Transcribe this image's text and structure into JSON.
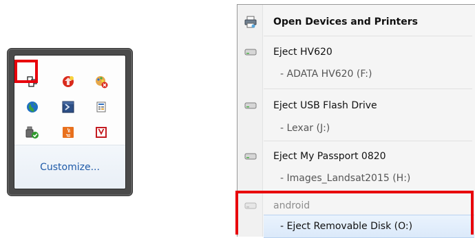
{
  "tray_popup": {
    "customize_label": "Customize...",
    "icons": [
      "network-windows-icon",
      "security-red-icon",
      "palette-x-icon",
      "globe-icon",
      "powershell-arrow-icon",
      "document-grid-icon",
      "usb-safely-remove-icon",
      "java-icon",
      "mcafee-shield-icon"
    ]
  },
  "menu": {
    "header_label": "Open Devices and Printers",
    "items": [
      {
        "label": "Eject HV620",
        "sub": "- ADATA HV620 (F:)"
      },
      {
        "label": "Eject USB Flash Drive",
        "sub": "- Lexar (J:)"
      },
      {
        "label": "Eject My Passport 0820",
        "sub": "- Images_Landsat2015 (H:)"
      }
    ],
    "android": {
      "label": "android",
      "sub": "- Eject Removable Disk (O:)"
    }
  },
  "colors": {
    "highlight": "#e8000b",
    "link_blue": "#1e5aa8"
  }
}
